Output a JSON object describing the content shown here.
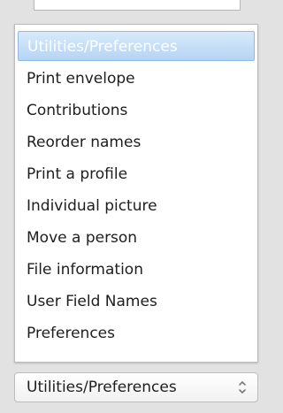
{
  "menu": {
    "items": [
      {
        "label": "Utilities/Preferences",
        "selected": true
      },
      {
        "label": "Print envelope",
        "selected": false
      },
      {
        "label": "Contributions",
        "selected": false
      },
      {
        "label": "Reorder names",
        "selected": false
      },
      {
        "label": "Print a profile",
        "selected": false
      },
      {
        "label": "Individual picture",
        "selected": false
      },
      {
        "label": "Move a person",
        "selected": false
      },
      {
        "label": "File information",
        "selected": false
      },
      {
        "label": "User Field Names",
        "selected": false
      },
      {
        "label": "Preferences",
        "selected": false
      }
    ]
  },
  "select": {
    "value": "Utilities/Preferences",
    "icon": "up-down-chevron-icon"
  },
  "colors": {
    "selection_top": "#d8eafb",
    "selection_bottom": "#b5d4f3",
    "selection_border": "#93b9e3",
    "background": "#e2e2e2"
  }
}
